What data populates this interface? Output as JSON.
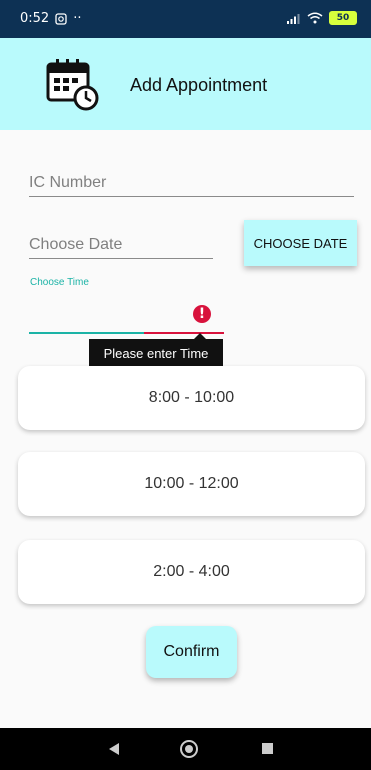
{
  "status_bar": {
    "time": "0:52",
    "dots": "··",
    "battery": "50"
  },
  "header": {
    "title": "Add Appointment",
    "icon": "calendar-clock-icon"
  },
  "form": {
    "ic_number_placeholder": "IC Number",
    "date_placeholder": "Choose Date",
    "choose_date_button": "CHOOSE DATE",
    "time_label": "Choose Time",
    "time_error": "Please enter Time"
  },
  "time_slots": [
    {
      "label": "8:00 - 10:00"
    },
    {
      "label": "10:00 - 12:00"
    },
    {
      "label": "2:00 - 4:00"
    }
  ],
  "confirm_button": "Confirm",
  "colors": {
    "status_bar": "#0d3154",
    "header_bg": "#b9fafc",
    "accent": "#1bb3a6",
    "error": "#d8123c"
  }
}
